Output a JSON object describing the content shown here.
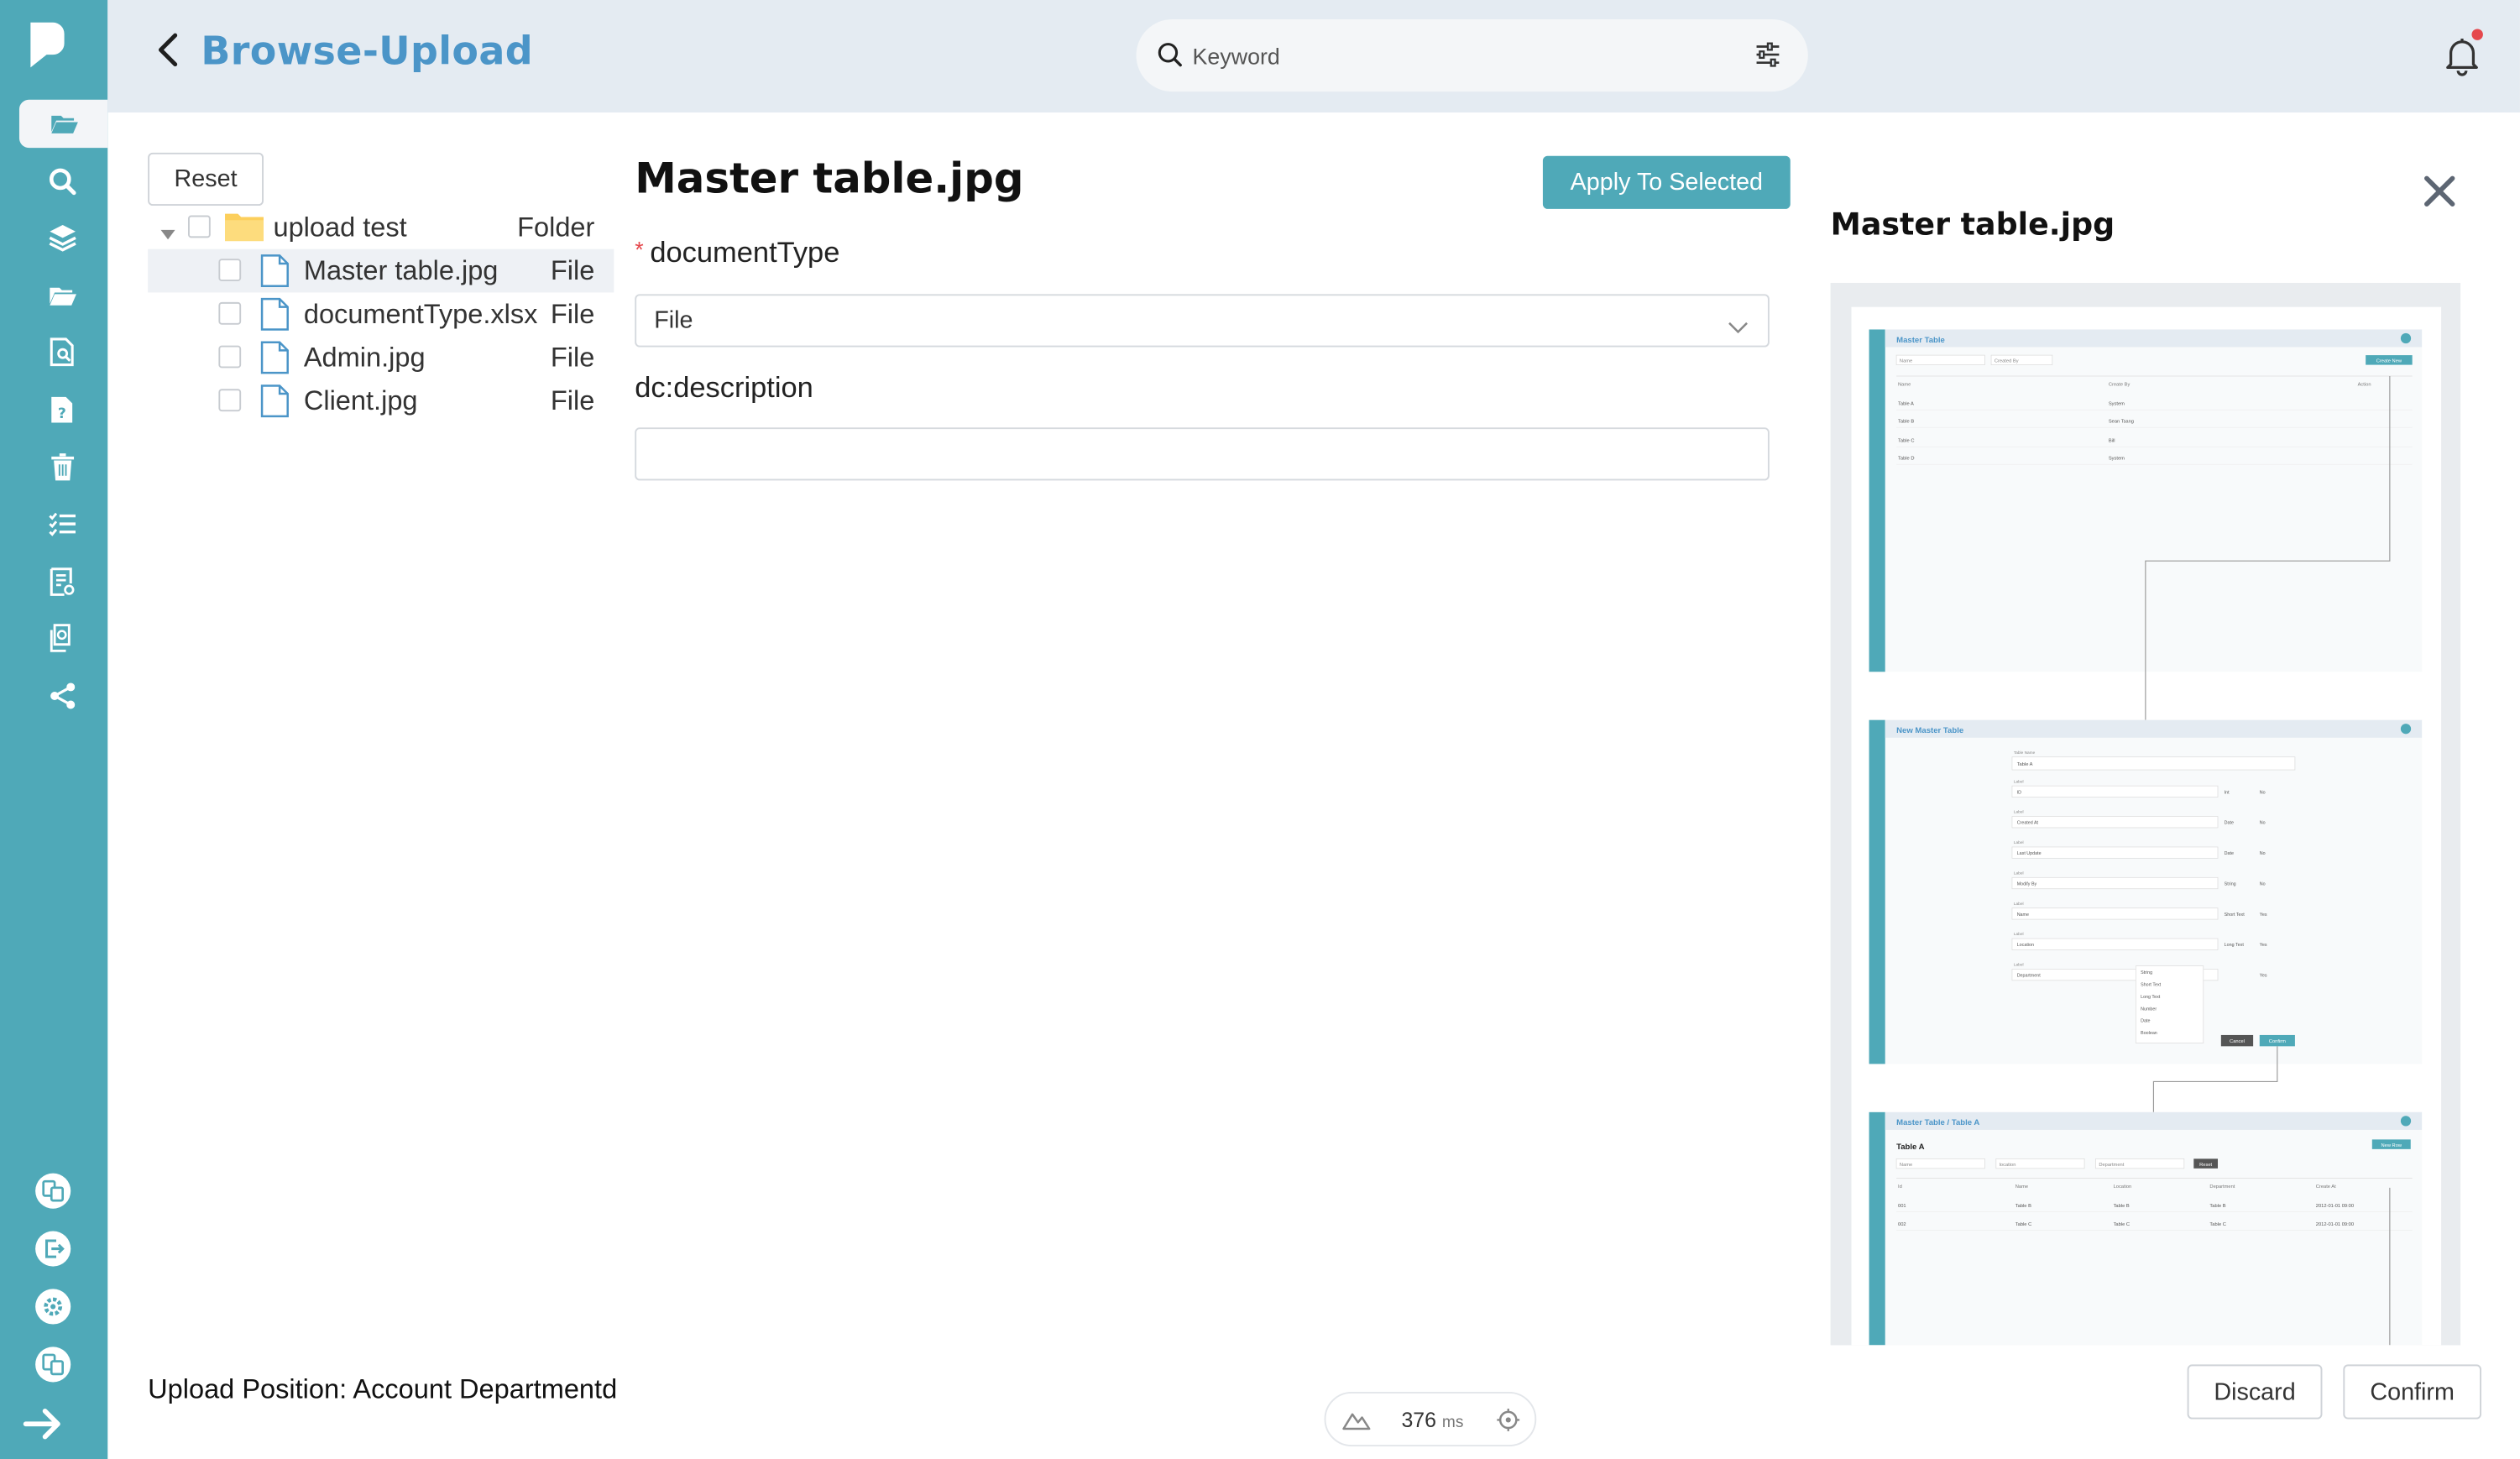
{
  "header": {
    "title": "Browse-Upload",
    "search_placeholder": "Keyword"
  },
  "sidebar": {
    "items": [
      {
        "icon": "folder-open-icon",
        "active": true
      },
      {
        "icon": "search-icon"
      },
      {
        "icon": "layers-icon"
      },
      {
        "icon": "folder-icon"
      },
      {
        "icon": "document-search-icon"
      },
      {
        "icon": "document-help-icon"
      },
      {
        "icon": "trash-icon"
      },
      {
        "icon": "checklist-icon"
      },
      {
        "icon": "report-icon"
      },
      {
        "icon": "document-refresh-icon"
      },
      {
        "icon": "share-icon"
      }
    ],
    "bottom_items": [
      "translate-icon",
      "logout-icon",
      "settings-icon",
      "language-icon",
      "collapse-arrow-icon"
    ],
    "accent_color": "#4fa9b8"
  },
  "tree": {
    "reset_label": "Reset",
    "folder": {
      "name": "upload test",
      "kind": "Folder"
    },
    "files": [
      {
        "name": "Master table.jpg",
        "kind": "File",
        "selected": true
      },
      {
        "name": "documentType.xlsx",
        "kind": "File"
      },
      {
        "name": "Admin.jpg",
        "kind": "File"
      },
      {
        "name": "Client.jpg",
        "kind": "File"
      }
    ]
  },
  "form": {
    "title": "Master table.jpg",
    "apply_label": "Apply To Selected",
    "document_type_label": "documentType",
    "document_type_value": "File",
    "description_label": "dc:description",
    "description_value": ""
  },
  "preview": {
    "title": "Master table.jpg",
    "screens": [
      {
        "title": "Master Table",
        "search_name": "Name",
        "search_created": "Created By",
        "button": "Create New",
        "columns": [
          "Name",
          "Create By",
          "Action"
        ],
        "rows": [
          [
            "Table A",
            "System"
          ],
          [
            "Table B",
            "Sean Tsang"
          ],
          [
            "Table C",
            "Bill"
          ],
          [
            "Table D",
            "System"
          ]
        ]
      },
      {
        "title": "New Master Table",
        "table_name_label": "Table Name",
        "table_name_value": "Table A",
        "fields": [
          {
            "label": "Label",
            "value": "ID",
            "type": "Int",
            "editable": "No"
          },
          {
            "label": "Label",
            "value": "Created At",
            "type": "Date",
            "editable": "No"
          },
          {
            "label": "Label",
            "value": "Last Update",
            "type": "Date",
            "editable": "No"
          },
          {
            "label": "Label",
            "value": "Modify By",
            "type": "String",
            "editable": "No"
          },
          {
            "label": "Label",
            "value": "Name",
            "type": "Short Text",
            "editable": "Yes"
          },
          {
            "label": "Label",
            "value": "Location",
            "type": "Long Text",
            "editable": "Yes"
          },
          {
            "label": "Label",
            "value": "Department",
            "type": "",
            "editable": "Yes"
          }
        ],
        "type_options": [
          "String",
          "Short Text",
          "Long Text",
          "Number",
          "Date",
          "Boolean"
        ],
        "cancel": "Cancel",
        "confirm": "Confirm"
      },
      {
        "title": "Master Table / Table A",
        "subtitle": "Table A",
        "button": "New Row",
        "filters": [
          "Name",
          "location",
          "Department"
        ],
        "reset": "Reset",
        "columns": [
          "Id",
          "Name",
          "Location",
          "Department",
          "Create At"
        ],
        "rows": [
          [
            "001",
            "Table B",
            "Table B",
            "Table B",
            "2012-01-01 09:00"
          ],
          [
            "002",
            "Table C",
            "Table C",
            "Table C",
            "2012-01-01 09:00"
          ]
        ]
      }
    ]
  },
  "footer": {
    "upload_position": "Upload Position: Account Departmentd",
    "perf_value": "376",
    "perf_unit": "ms",
    "discard_label": "Discard",
    "confirm_label": "Confirm"
  }
}
